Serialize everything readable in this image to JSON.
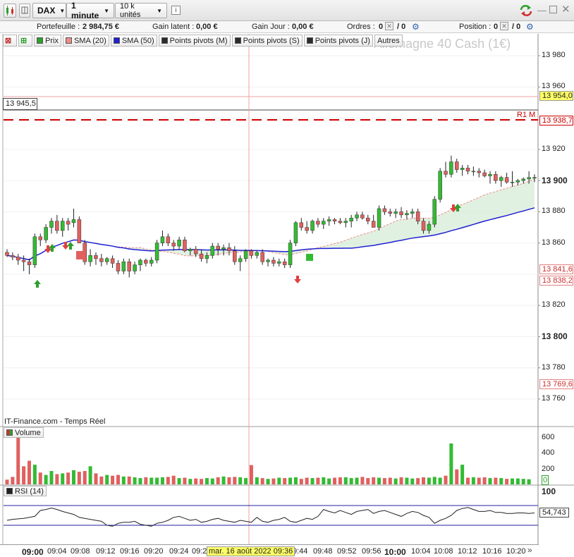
{
  "toolbar": {
    "instrument": "DAX",
    "interval": "1 minute",
    "units": "10 k unités",
    "info_icon": "info-icon",
    "refresh_icon": "refresh-icon"
  },
  "infobar": {
    "portfolio_label": "Portefeuille :",
    "portfolio_value": "2 984,75 €",
    "latent_label": "Gain latent :",
    "latent_value": "0,00 €",
    "day_label": "Gain Jour :",
    "day_value": "0,00 €",
    "orders_label": "Ordres :",
    "orders_a": "0",
    "orders_b": "/ 0",
    "position_label": "Position :",
    "position_a": "0",
    "position_b": "/ 0"
  },
  "indicators": [
    {
      "label": "Prix",
      "color": "#2ea02e"
    },
    {
      "label": "SMA (20)",
      "color": "#f08a8a"
    },
    {
      "label": "SMA (50)",
      "color": "#2020d0"
    },
    {
      "label": "Points pivots (M)",
      "color": "#2b2b2b"
    },
    {
      "label": "Points pivots (S)",
      "color": "#2b2b2b"
    },
    {
      "label": "Points pivots (J)",
      "color": "#2b2b2b"
    },
    {
      "label": "Autres",
      "color": ""
    }
  ],
  "watermark": "Allemagne 40 Cash (1€)",
  "source": "IT-Finance.com - Temps Réel",
  "crosshair_value": "13 945,5",
  "crosshair_time": "mar. 16 août 2022 09:36",
  "pivot_label": "R1 M",
  "price_axis": [
    "13 980",
    "13 960",
    "13 920",
    "13 900",
    "13 880",
    "13 860",
    "13 820",
    "13 800",
    "13 780",
    "13 760"
  ],
  "price_tags": {
    "crosshair": "13 954,0",
    "r1m": "13 938,7",
    "sma_a": "13 841,6",
    "sma_b": "13 838,2",
    "low": "13 769,6"
  },
  "volume": {
    "label": "Volume",
    "axis": [
      "600",
      "400",
      "200",
      "0"
    ]
  },
  "rsi": {
    "label": "RSI (14)",
    "axis_top": "100",
    "value": "54,743"
  },
  "time_axis": [
    "09:00",
    "09:04",
    "09:08",
    "09:12",
    "09:16",
    "09:20",
    "09:24",
    "09:2",
    "9:44",
    "09:48",
    "09:52",
    "09:56",
    "10:00",
    "10:04",
    "10:08",
    "10:12",
    "10:16",
    "10:20"
  ],
  "colors": {
    "up": "#33bb33",
    "down": "#e06060",
    "sma20": "#f08a8a",
    "sma50": "#2020d0",
    "pivot": "#cc0000"
  },
  "chart_data": {
    "type": "candlestick",
    "ylim": [
      13750,
      13990
    ],
    "candles": [
      [
        13854,
        13856,
        13851,
        13852
      ],
      [
        13852,
        13854,
        13849,
        13851
      ],
      [
        13851,
        13853,
        13846,
        13849
      ],
      [
        13849,
        13852,
        13842,
        13848
      ],
      [
        13848,
        13850,
        13840,
        13846
      ],
      [
        13846,
        13866,
        13844,
        13864
      ],
      [
        13864,
        13866,
        13858,
        13862
      ],
      [
        13862,
        13872,
        13860,
        13870
      ],
      [
        13870,
        13876,
        13866,
        13874
      ],
      [
        13874,
        13878,
        13866,
        13868
      ],
      [
        13868,
        13876,
        13864,
        13874
      ],
      [
        13874,
        13876,
        13868,
        13872
      ],
      [
        13873,
        13882,
        13870,
        13875
      ],
      [
        13875,
        13877,
        13860,
        13860
      ],
      [
        13860,
        13862,
        13846,
        13848
      ],
      [
        13848,
        13856,
        13845,
        13852
      ],
      [
        13852,
        13854,
        13846,
        13850
      ],
      [
        13850,
        13853,
        13845,
        13848
      ],
      [
        13848,
        13851,
        13846,
        13850
      ],
      [
        13850,
        13852,
        13844,
        13847
      ],
      [
        13847,
        13849,
        13840,
        13842
      ],
      [
        13842,
        13850,
        13840,
        13848
      ],
      [
        13848,
        13850,
        13838,
        13842
      ],
      [
        13842,
        13848,
        13840,
        13846
      ],
      [
        13846,
        13850,
        13842,
        13849
      ],
      [
        13849,
        13850,
        13845,
        13847
      ],
      [
        13847,
        13851,
        13845,
        13849
      ],
      [
        13849,
        13862,
        13847,
        13860
      ],
      [
        13860,
        13868,
        13858,
        13864
      ],
      [
        13864,
        13866,
        13858,
        13860
      ],
      [
        13860,
        13862,
        13855,
        13858
      ],
      [
        13858,
        13864,
        13856,
        13862
      ],
      [
        13862,
        13864,
        13854,
        13855
      ],
      [
        13855,
        13857,
        13852,
        13856
      ],
      [
        13856,
        13858,
        13851,
        13853
      ],
      [
        13853,
        13856,
        13848,
        13850
      ],
      [
        13850,
        13854,
        13847,
        13852
      ],
      [
        13852,
        13860,
        13850,
        13858
      ],
      [
        13858,
        13860,
        13852,
        13856
      ],
      [
        13856,
        13859,
        13852,
        13857
      ],
      [
        13857,
        13860,
        13852,
        13855
      ],
      [
        13855,
        13858,
        13846,
        13848
      ],
      [
        13848,
        13852,
        13842,
        13850
      ],
      [
        13850,
        13856,
        13848,
        13855
      ],
      [
        13855,
        13856,
        13850,
        13852
      ],
      [
        13852,
        13855,
        13850,
        13854
      ],
      [
        13854,
        13856,
        13846,
        13848
      ],
      [
        13848,
        13850,
        13845,
        13849
      ],
      [
        13849,
        13851,
        13845,
        13847
      ],
      [
        13847,
        13850,
        13845,
        13848
      ],
      [
        13848,
        13850,
        13844,
        13846
      ],
      [
        13846,
        13862,
        13844,
        13860
      ],
      [
        13860,
        13874,
        13858,
        13873
      ],
      [
        13873,
        13876,
        13868,
        13870
      ],
      [
        13870,
        13874,
        13866,
        13868
      ],
      [
        13868,
        13875,
        13866,
        13874
      ],
      [
        13874,
        13876,
        13870,
        13872
      ],
      [
        13872,
        13876,
        13869,
        13874
      ],
      [
        13874,
        13877,
        13871,
        13875
      ],
      [
        13875,
        13876,
        13872,
        13874
      ],
      [
        13874,
        13876,
        13872,
        13873
      ],
      [
        13873,
        13876,
        13870,
        13874
      ],
      [
        13874,
        13878,
        13870,
        13876
      ],
      [
        13876,
        13880,
        13874,
        13878
      ],
      [
        13878,
        13880,
        13875,
        13876
      ],
      [
        13876,
        13878,
        13872,
        13874
      ],
      [
        13874,
        13878,
        13870,
        13870
      ],
      [
        13870,
        13884,
        13868,
        13882
      ],
      [
        13882,
        13884,
        13878,
        13880
      ],
      [
        13880,
        13882,
        13877,
        13879
      ],
      [
        13879,
        13882,
        13876,
        13880
      ],
      [
        13880,
        13883,
        13876,
        13878
      ],
      [
        13878,
        13881,
        13875,
        13879
      ],
      [
        13879,
        13882,
        13876,
        13880
      ],
      [
        13880,
        13882,
        13872,
        13874
      ],
      [
        13874,
        13876,
        13866,
        13868
      ],
      [
        13868,
        13874,
        13866,
        13872
      ],
      [
        13872,
        13890,
        13870,
        13888
      ],
      [
        13888,
        13908,
        13886,
        13906
      ],
      [
        13906,
        13912,
        13902,
        13904
      ],
      [
        13904,
        13916,
        13902,
        13912
      ],
      [
        13912,
        13914,
        13905,
        13907
      ],
      [
        13907,
        13910,
        13903,
        13908
      ],
      [
        13908,
        13910,
        13904,
        13906
      ],
      [
        13906,
        13909,
        13903,
        13906
      ],
      [
        13906,
        13908,
        13902,
        13905
      ],
      [
        13905,
        13907,
        13902,
        13903
      ],
      [
        13903,
        13906,
        13898,
        13904
      ],
      [
        13904,
        13906,
        13898,
        13900
      ],
      [
        13900,
        13903,
        13896,
        13902
      ],
      [
        13902,
        13905,
        13898,
        13899
      ],
      [
        13899,
        13906,
        13896,
        13899
      ],
      [
        13899,
        13901,
        13897,
        13900
      ],
      [
        13900,
        13902,
        13898,
        13901
      ],
      [
        13901,
        13906,
        13898,
        13902
      ],
      [
        13902,
        13904,
        13899,
        13902
      ]
    ],
    "volume": [
      60,
      95,
      600,
      230,
      300,
      250,
      150,
      120,
      170,
      130,
      140,
      150,
      180,
      160,
      170,
      230,
      140,
      100,
      120,
      110,
      120,
      100,
      100,
      90,
      80,
      90,
      85,
      85,
      90,
      95,
      110,
      80,
      85,
      70,
      75,
      70,
      80,
      75,
      90,
      100,
      90,
      95,
      90,
      80,
      245,
      90,
      80,
      70,
      75,
      85,
      80,
      85,
      90,
      70,
      85,
      80,
      85,
      90,
      75,
      85,
      90,
      90,
      80,
      85,
      95,
      80,
      90,
      85,
      80,
      85,
      75,
      90,
      85,
      75,
      80,
      90,
      85,
      95,
      85,
      110,
      520,
      190,
      250,
      85,
      90,
      85,
      90,
      80,
      85,
      80,
      70,
      75,
      75,
      70,
      65
    ],
    "rsi": [
      40,
      42,
      43,
      44,
      46,
      48,
      60,
      62,
      65,
      62,
      58,
      55,
      52,
      46,
      44,
      42,
      40,
      38,
      30,
      28,
      34,
      36,
      36,
      38,
      32,
      30,
      28,
      34,
      36,
      40,
      46,
      48,
      44,
      40,
      42,
      36,
      38,
      42,
      44,
      40,
      38,
      36,
      40,
      38,
      36,
      46,
      38,
      36,
      40,
      42,
      46,
      38,
      36,
      40,
      44,
      42,
      48,
      62,
      58,
      55,
      60,
      56,
      52,
      58,
      60,
      62,
      54,
      58,
      60,
      56,
      52,
      48,
      54,
      58,
      56,
      50,
      46,
      34,
      40,
      44,
      50,
      60,
      64,
      66,
      62,
      58,
      58,
      60,
      56,
      56,
      54,
      54,
      55,
      55,
      54,
      55
    ]
  }
}
